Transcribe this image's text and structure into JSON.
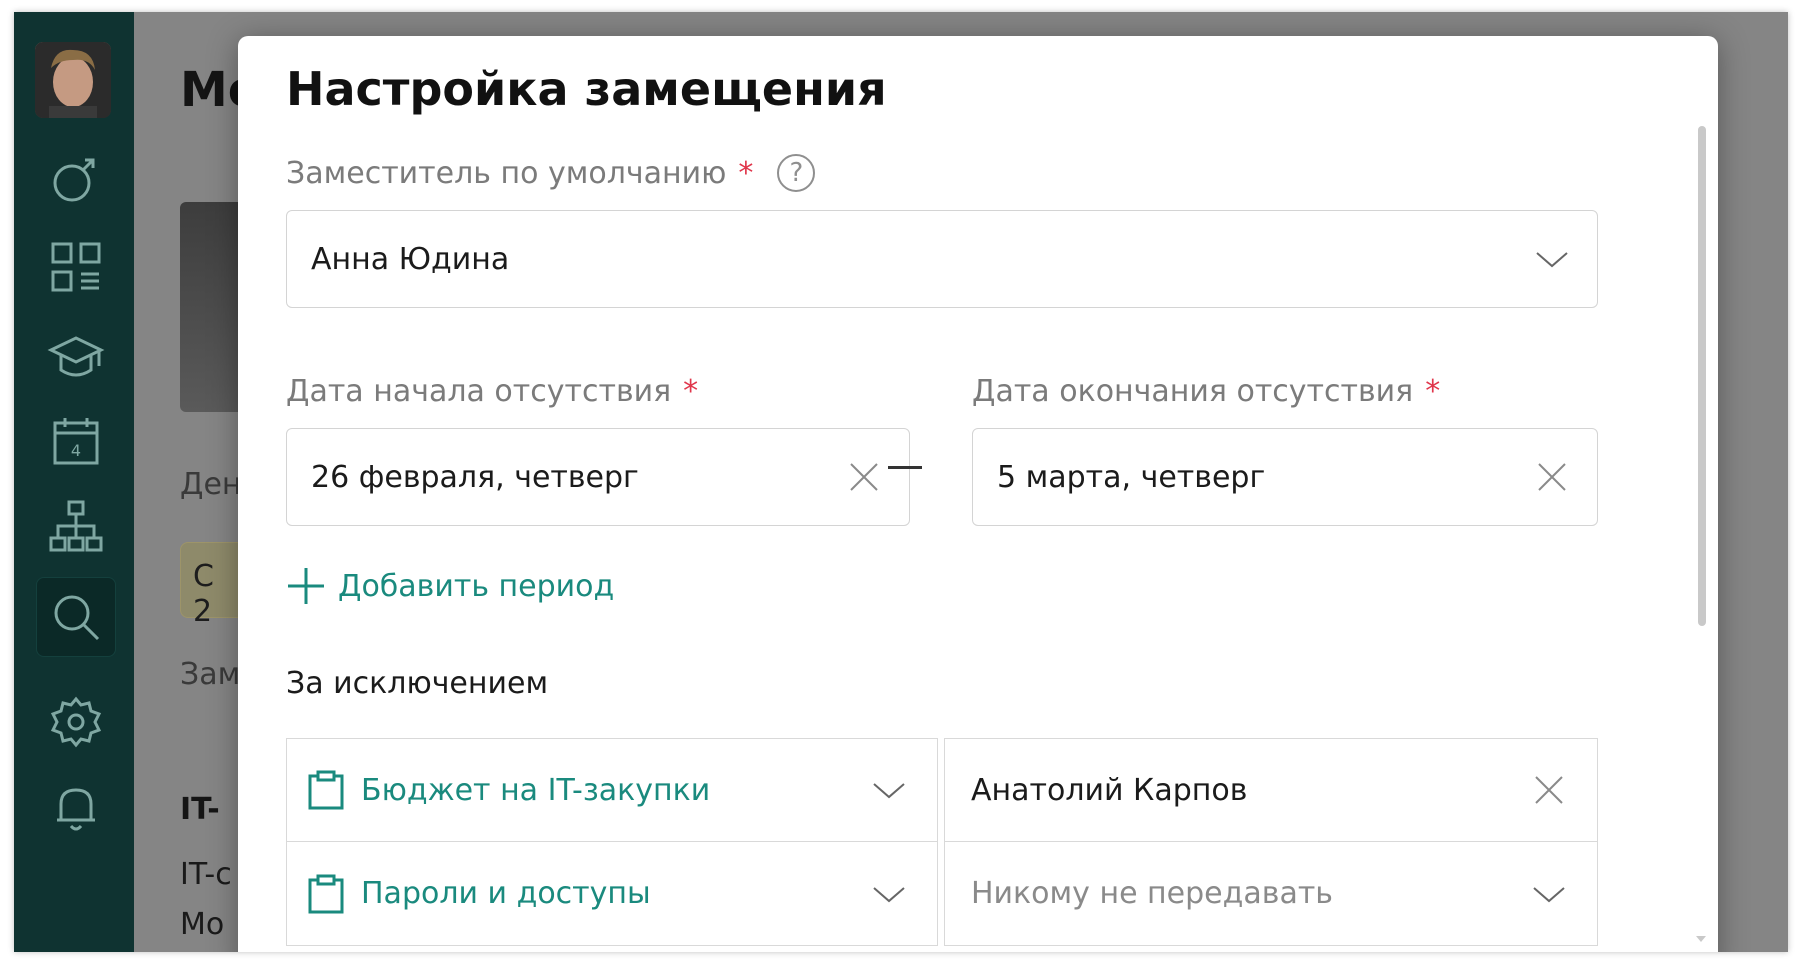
{
  "sidebar": {
    "avatar_alt": "",
    "items": [
      {
        "name": "goals",
        "icon": "bubble-arrow-icon"
      },
      {
        "name": "dashboard",
        "icon": "grid-list-icon"
      },
      {
        "name": "learning",
        "icon": "graduation-cap-icon"
      },
      {
        "name": "calendar",
        "icon": "calendar-icon",
        "day": "4"
      },
      {
        "name": "structure",
        "icon": "org-chart-icon"
      },
      {
        "name": "search",
        "icon": "search-icon",
        "active": true
      },
      {
        "name": "settings",
        "icon": "gear-icon"
      },
      {
        "name": "notifications",
        "icon": "bell-icon"
      }
    ]
  },
  "background": {
    "title_fragment": "Мо",
    "text_1": "Ден",
    "pill": "С 2",
    "text_2": "Зам",
    "heading_fragment": "IT-",
    "text_3": "IT-с",
    "text_4": "Мо"
  },
  "modal": {
    "title": "Настройка замещения",
    "deputy_label": "Заместитель по умолчанию",
    "required_mark": "*",
    "deputy_value": "Анна Юдина",
    "start_label": "Дата начала отсутствия",
    "start_value": "26 февраля, четверг",
    "end_label": "Дата окончания отсутствия",
    "end_value": "5 марта, четверг",
    "add_period": "Добавить период",
    "exceptions_title": "За исключением",
    "exceptions": [
      {
        "category": "Бюджет на IT-закупки",
        "assignee": "Анатолий Карпов",
        "assignee_placeholder": false
      },
      {
        "category": "Пароли и доступы",
        "assignee": "Никому не передавать",
        "assignee_placeholder": true
      }
    ]
  },
  "colors": {
    "sidebar_bg": "#0f3331",
    "accent_teal": "#1a8a7e",
    "required_red": "#e0364b"
  }
}
